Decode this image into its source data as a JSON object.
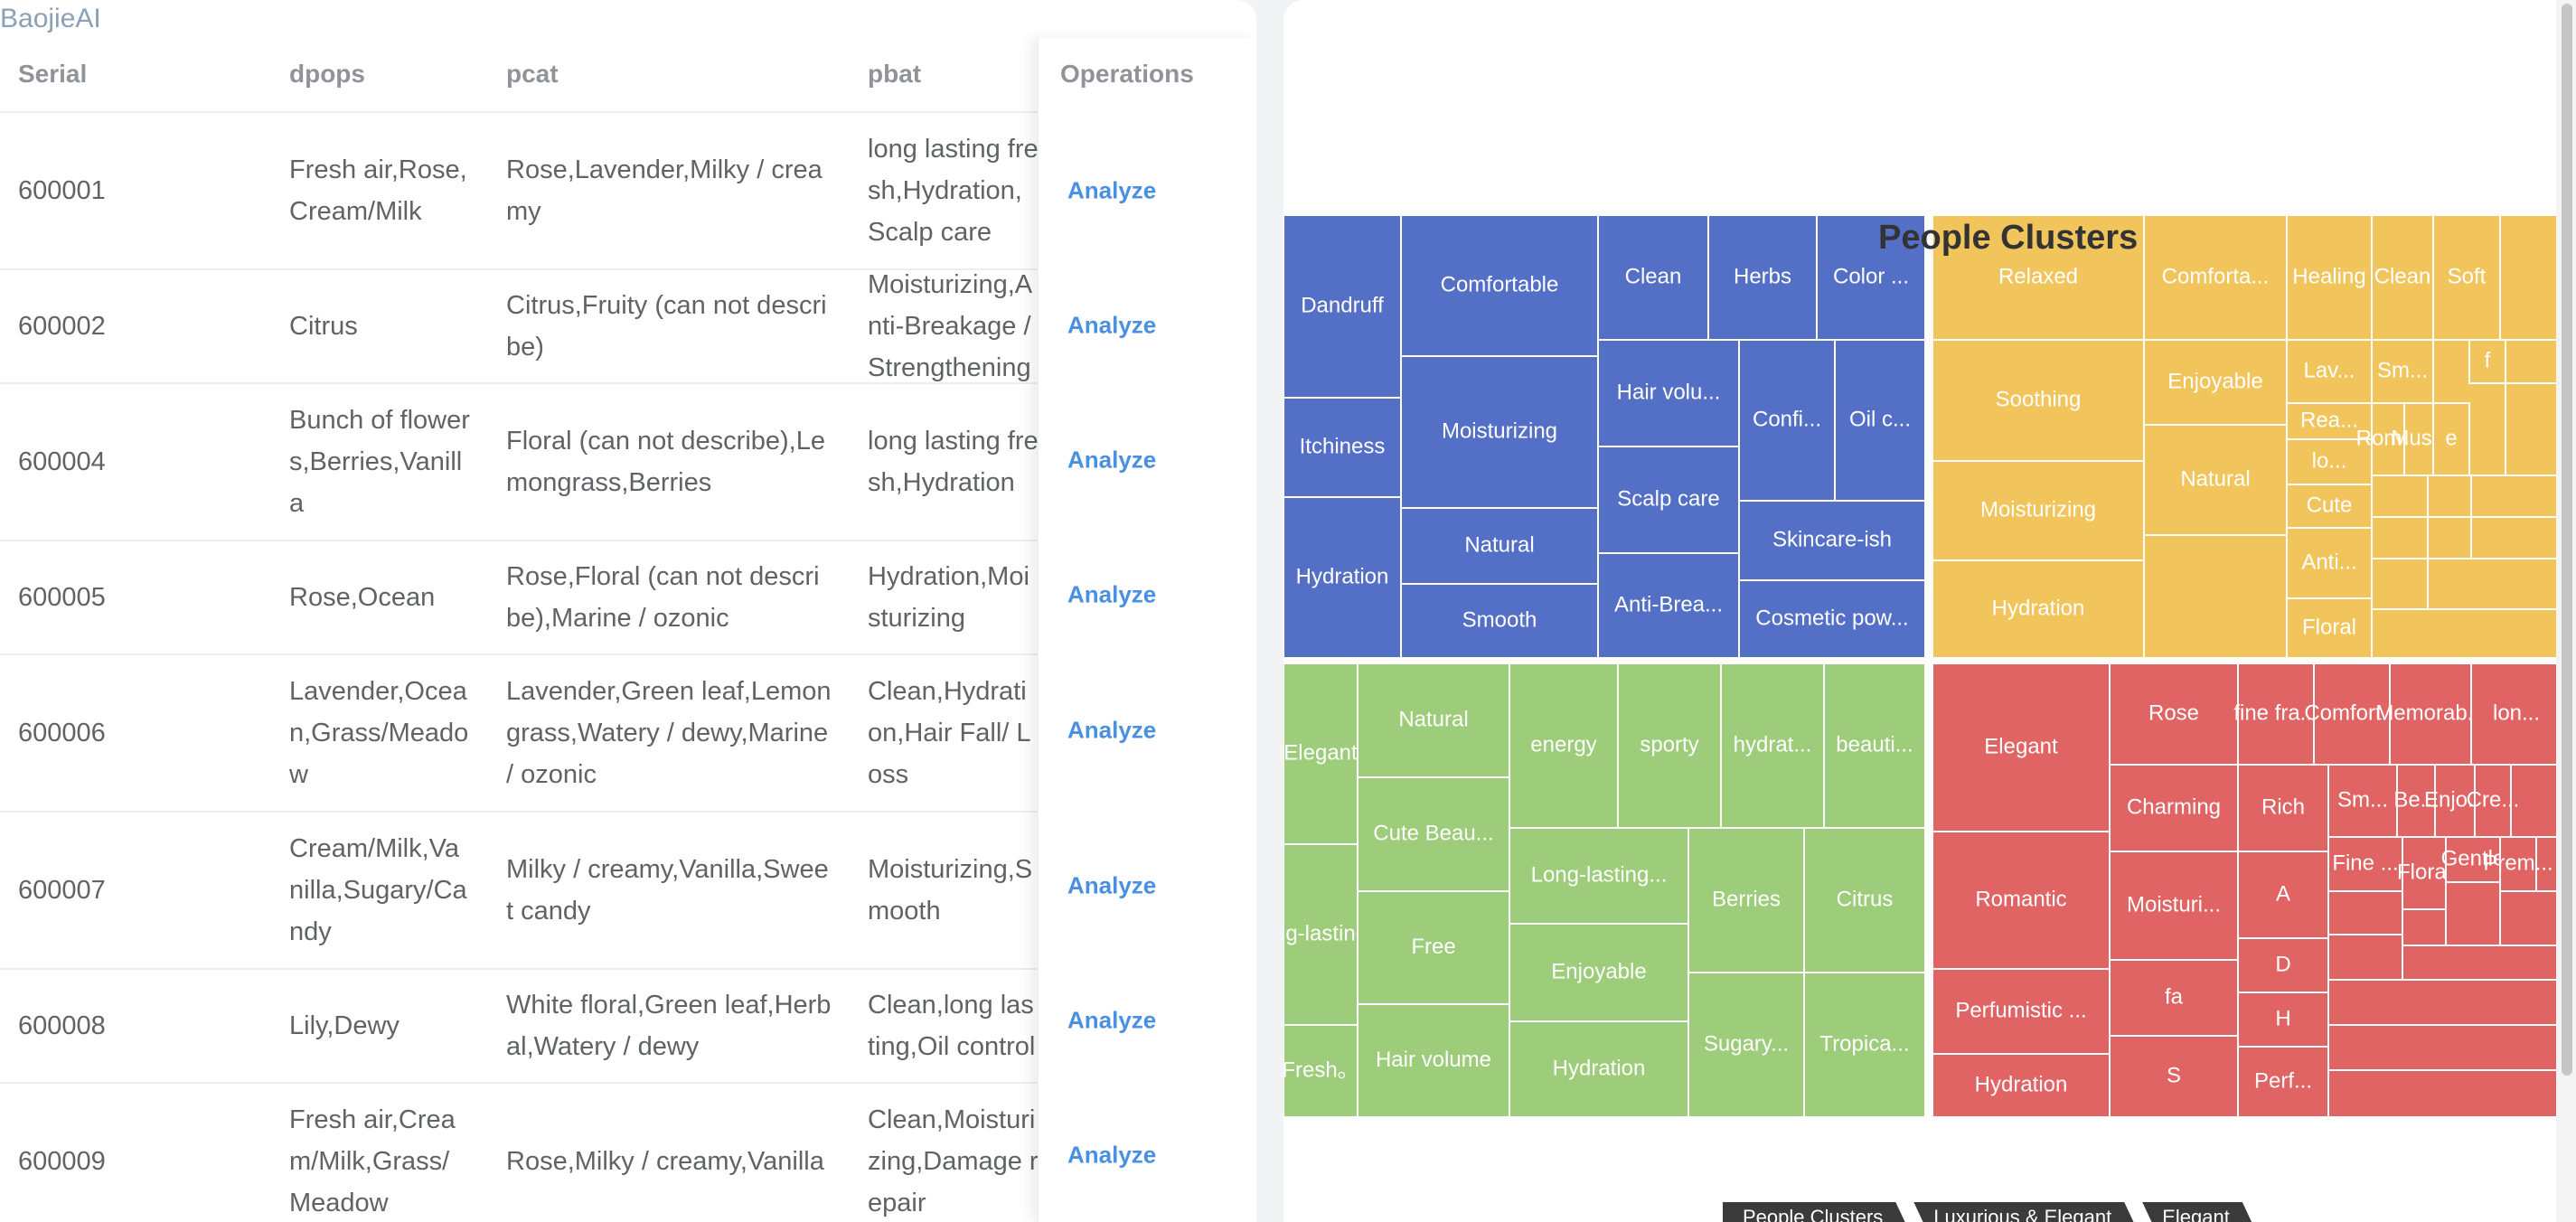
{
  "app": {
    "name": "BaojieAI"
  },
  "table": {
    "columns": [
      "Serial",
      "dpops",
      "pcat",
      "pbat",
      "Operations"
    ],
    "rows": [
      {
        "serial": "600001",
        "dpops": "Fresh air,Rose,Cream/Milk",
        "pcat": "Rose,Lavender,Milky / creamy",
        "pbat": "long lasting fresh,Hydration,Scalp care",
        "action": "Analyze"
      },
      {
        "serial": "600002",
        "dpops": "Citrus",
        "pcat": "Citrus,Fruity (can not describe)",
        "pbat": "Moisturizing,Anti-Breakage / Strengthening",
        "action": "Analyze"
      },
      {
        "serial": "600004",
        "dpops": "Bunch of flowers,Berries,Vanilla",
        "pcat": "Floral (can not describe),Lemongrass,Berries",
        "pbat": "long lasting fresh,Hydration",
        "action": "Analyze"
      },
      {
        "serial": "600005",
        "dpops": "Rose,Ocean",
        "pcat": "Rose,Floral (can not describe),Marine / ozonic",
        "pbat": "Hydration,Moisturizing",
        "action": "Analyze"
      },
      {
        "serial": "600006",
        "dpops": "Lavender,Ocean,Grass/Meadow",
        "pcat": "Lavender,Green leaf,Lemongrass,Watery / dewy,Marine / ozonic",
        "pbat": "Clean,Hydration,Hair Fall/ Loss",
        "action": "Analyze"
      },
      {
        "serial": "600007",
        "dpops": "Cream/Milk,Vanilla,Sugary/Candy",
        "pcat": "Milky / creamy,Vanilla,Sweet candy",
        "pbat": "Moisturizing,Smooth",
        "action": "Analyze"
      },
      {
        "serial": "600008",
        "dpops": "Lily,Dewy",
        "pcat": "White floral,Green leaf,Herbal,Watery / dewy",
        "pbat": "Clean,long lasting,Oil control",
        "action": "Analyze"
      },
      {
        "serial": "600009",
        "dpops": "Fresh air,Cream/Milk,Grass/Meadow",
        "pcat": "Rose,Milky / creamy,Vanilla",
        "pbat": "Clean,Moisturizing,Damage repair",
        "action": "Analyze"
      }
    ]
  },
  "chart": {
    "title": "People Clusters",
    "breadcrumb": [
      "People Clusters",
      "Luxurious & Elegant",
      "Elegant"
    ],
    "colors": {
      "blue": "#5470c6",
      "yellow": "#f2c55c",
      "green": "#9dcc7a",
      "red": "#e06464"
    }
  },
  "chart_data": {
    "type": "treemap",
    "title": "People Clusters",
    "groups": [
      {
        "color": "#5470c6",
        "nodes": [
          "Dandruff",
          "Itchiness",
          "Hydration",
          "Comfortable",
          "Moisturizing",
          "Natural",
          "Smooth",
          "Clean",
          "Herbs",
          "Color ...",
          "Hair volu...",
          "Confi...",
          "Oil c...",
          "Scalp care",
          "Skincare-ish",
          "Anti-Brea...",
          "Cosmetic pow..."
        ]
      },
      {
        "color": "#f2c55c",
        "nodes": [
          "Relaxed",
          "Soothing",
          "Moisturizing",
          "Hydration",
          "Comforta...",
          "Enjoyable",
          "Natural",
          "Healing",
          "Clean",
          "Soft",
          "Lav...",
          "Sm...",
          "Rea...",
          "lo...",
          "Cute",
          "Anti...",
          "Floral",
          "Rom...",
          "Mus...",
          "e",
          "f"
        ]
      },
      {
        "color": "#9dcc7a",
        "nodes": [
          "Elegant",
          "Long-lasting ...",
          "Fresh。",
          "Natural",
          "Cute Beau...",
          "Free",
          "Hair volume",
          "energy",
          "sporty",
          "hydrat...",
          "beauti...",
          "Long-lasting...",
          "Enjoyable",
          "Hydration",
          "Berries",
          "Citrus",
          "Sugary...",
          "Tropica..."
        ]
      },
      {
        "color": "#e06464",
        "nodes": [
          "Elegant",
          "Romantic",
          "Perfumistic ...",
          "Hydration",
          "Rose",
          "Charming",
          "Moisturi...",
          "fine fra...",
          "Comfort...",
          "Memorab...",
          "lon...",
          "Rich",
          "Sm...",
          "Be...",
          "Enjo...",
          "Cre...",
          "A",
          "D",
          "H",
          "Perf...",
          "Fine ...",
          "Floral",
          "Gentle",
          "Prem...",
          "fa",
          "S"
        ]
      }
    ]
  }
}
